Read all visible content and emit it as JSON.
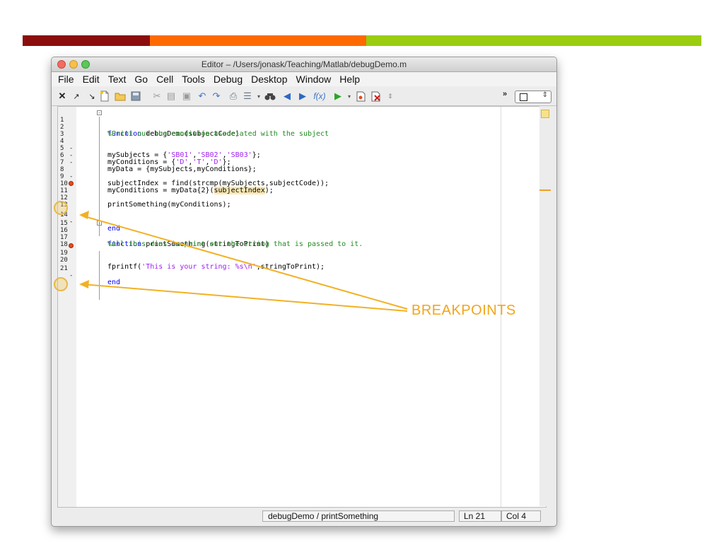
{
  "decor": {
    "bar_colors": [
      "#8b0d0d",
      "#ff6a00",
      "#9acd0f"
    ]
  },
  "window": {
    "title": "Editor – /Users/jonask/Teaching/Matlab/debugDemo.m"
  },
  "menu": {
    "items": [
      "File",
      "Edit",
      "Text",
      "Go",
      "Cell",
      "Tools",
      "Debug",
      "Desktop",
      "Window",
      "Help"
    ]
  },
  "toolbar": {
    "icons": [
      "close-icon",
      "undock-icon",
      "dock-icon",
      "new-file-icon",
      "open-folder-icon",
      "save-icon",
      "cut-icon",
      "copy-icon",
      "paste-icon",
      "undo-icon",
      "redo-icon",
      "print-icon",
      "indent-icon",
      "find-icon",
      "back-icon",
      "forward-icon",
      "function-icon",
      "run-icon",
      "set-breakpoint-icon",
      "clear-breakpoints-icon",
      "stepper-icon",
      "overflow-icon",
      "layout-toggle-icon"
    ]
  },
  "code": {
    "lines": [
      {
        "num": "1",
        "text": "function debugDemo(subjectCode)"
      },
      {
        "num": "2",
        "text": "%Print out the condition associated with the subject"
      },
      {
        "num": "3",
        "text": ""
      },
      {
        "num": "4",
        "text": "mySubjects = {'SB01','SB02','SB03'};"
      },
      {
        "num": "5",
        "text": "myConditions = {'D','T','D'};"
      },
      {
        "num": "6",
        "text": "myData = {mySubjects,myConditions};"
      },
      {
        "num": "7",
        "text": ""
      },
      {
        "num": "8",
        "text": "subjectIndex = find(strcmp(mySubjects,subjectCode));"
      },
      {
        "num": "9",
        "text": "myConditions = myData{2}(subjectIndex);"
      },
      {
        "num": "10",
        "text": ""
      },
      {
        "num": "11",
        "text": "printSomething(myConditions);"
      },
      {
        "num": "12",
        "text": ""
      },
      {
        "num": "13",
        "text": ""
      },
      {
        "num": "14",
        "text": "end"
      },
      {
        "num": "15",
        "text": ""
      },
      {
        "num": "16",
        "text": "function printSomething(stringToPrint)"
      },
      {
        "num": "17",
        "text": "%All this does is print out the string that is passed to it."
      },
      {
        "num": "18",
        "text": ""
      },
      {
        "num": "19",
        "text": "fprintf('This is your string: %s\\n',stringToPrint);"
      },
      {
        "num": "20",
        "text": ""
      },
      {
        "num": "21",
        "text": "end"
      }
    ]
  },
  "status": {
    "function": "debugDemo / printSomething",
    "line": "Ln  21",
    "column": "Col  4"
  },
  "annotation": {
    "label": "BREAKPOINTS",
    "color": "#f2a51a"
  }
}
